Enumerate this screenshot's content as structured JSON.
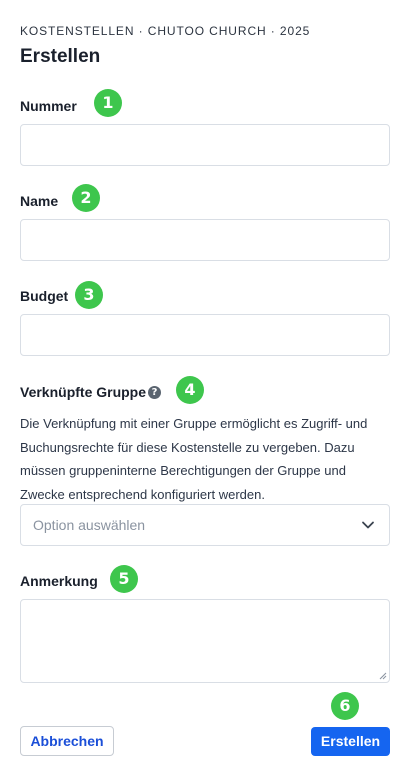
{
  "header": {
    "breadcrumb": "KOSTENSTELLEN · CHUTOO CHURCH · 2025",
    "title": "Erstellen"
  },
  "form": {
    "nummer": {
      "label": "Nummer",
      "value": ""
    },
    "name": {
      "label": "Name",
      "value": ""
    },
    "budget": {
      "label": "Budget",
      "value": ""
    },
    "gruppe": {
      "label": "Verknüpfte Gruppe",
      "help_icon": "?",
      "description": "Die Verknüpfung mit einer Gruppe ermöglicht es Zugriff- und Buchungsrechte für diese Kostenstelle zu vergeben. Dazu müssen gruppeninterne Berechtigungen der Gruppe und Zwecke entsprechend konfiguriert werden.",
      "placeholder": "Option auswählen"
    },
    "anmerkung": {
      "label": "Anmerkung",
      "value": ""
    }
  },
  "actions": {
    "cancel_label": "Abbrechen",
    "submit_label": "Erstellen"
  },
  "annotations": [
    "1",
    "2",
    "3",
    "4",
    "5",
    "6"
  ],
  "colors": {
    "badge": "#3ec64d",
    "primary": "#1565f0",
    "link": "#1b4fd8",
    "border": "#d9dee5"
  }
}
